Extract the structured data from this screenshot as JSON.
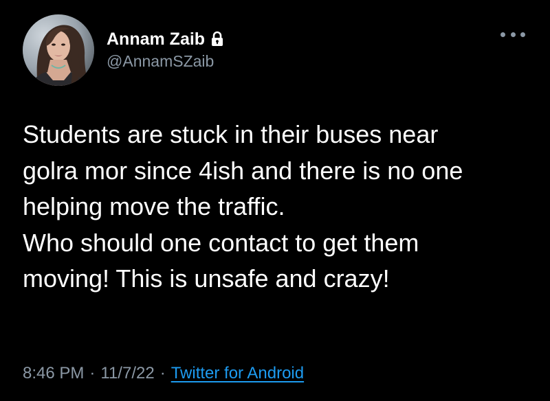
{
  "tweet": {
    "author": {
      "display_name": "Annam Zaib",
      "handle": "@AnnamSZaib",
      "protected_icon": "lock-icon",
      "avatar": "profile-photo"
    },
    "more_icon": "ellipsis-icon",
    "text_lines": [
      "Students are stuck in their buses near",
      "golra mor since 4ish and there is no one",
      "helping move the traffic.",
      "Who should one contact to get them",
      "moving! This is unsafe and crazy!"
    ],
    "time": "8:46 PM",
    "date": "11/7/22",
    "separator": "·",
    "source": "Twitter for Android"
  },
  "colors": {
    "background": "#000000",
    "text_primary": "#ffffff",
    "text_secondary": "#8b98a5",
    "link": "#1d9bf0"
  }
}
